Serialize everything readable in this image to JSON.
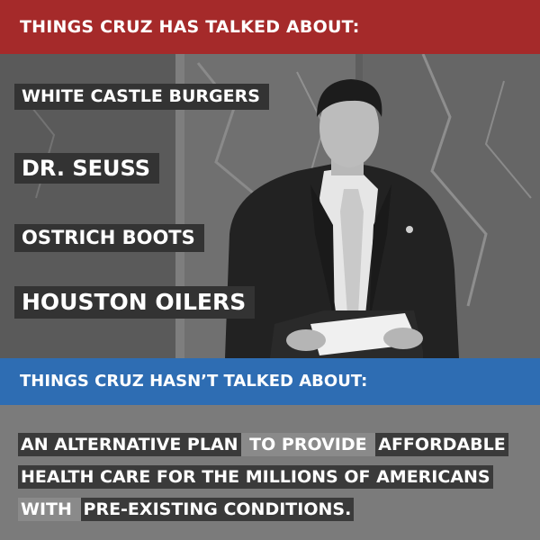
{
  "header": {
    "title": "THINGS CRUZ HAS TALKED ABOUT:"
  },
  "talked_items": [
    "WHITE CASTLE BURGERS",
    "DR. SEUSS",
    "OSTRICH BOOTS",
    "HOUSTON OILERS"
  ],
  "middle": {
    "title": "THINGS CRUZ HASN’T TALKED ABOUT:"
  },
  "statement": {
    "line1": [
      "AN ALTERNATIVE PLAN",
      " TO PROVIDE ",
      "AFFORDABLE"
    ],
    "line2": [
      "HEALTH CARE FOR THE MILLIONS OF AMERICANS"
    ],
    "line3": [
      "WITH ",
      "PRE-EXISTING CONDITIONS."
    ]
  },
  "colors": {
    "top_banner": "#a52a2a",
    "mid_banner": "#2e6db3",
    "label_box": "#333333"
  }
}
